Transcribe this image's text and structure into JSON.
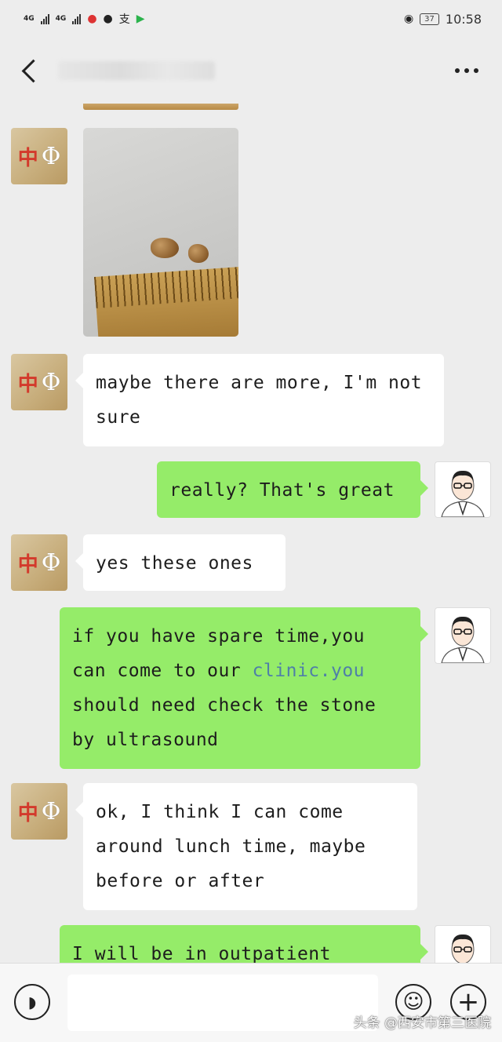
{
  "status_bar": {
    "network_1": "4G",
    "network_2": "4G",
    "battery": "37",
    "time": "10:58"
  },
  "messages": [
    {
      "side": "received",
      "type": "image"
    },
    {
      "side": "received",
      "type": "text",
      "text": "maybe there are more, I'm not sure"
    },
    {
      "side": "sent",
      "type": "text",
      "text": "really? That's great"
    },
    {
      "side": "received",
      "type": "text",
      "text": "yes these ones"
    },
    {
      "side": "sent",
      "type": "text",
      "text_before_link": "if you have spare time,you can come to our ",
      "link_text": "clinic.you",
      "text_after_link": " should need check the stone by ultrasound"
    },
    {
      "side": "received",
      "type": "text",
      "text": "ok, I think I can come around lunch time, maybe before or after"
    },
    {
      "side": "sent",
      "type": "text",
      "text": "I will be in outpatient  clinic"
    }
  ],
  "avatar_logo": {
    "char_cn": "中",
    "char_symbol": "Φ"
  },
  "input_bar": {
    "placeholder": ""
  },
  "watermark": "头条 @西安市第三医院",
  "colors": {
    "sent_bubble": "#95ec69",
    "received_bubble": "#ffffff",
    "background": "#ededed",
    "link": "#4f7fa8"
  },
  "icons": [
    "back-icon",
    "more-icon",
    "voice-icon",
    "emoji-icon",
    "plus-icon"
  ]
}
